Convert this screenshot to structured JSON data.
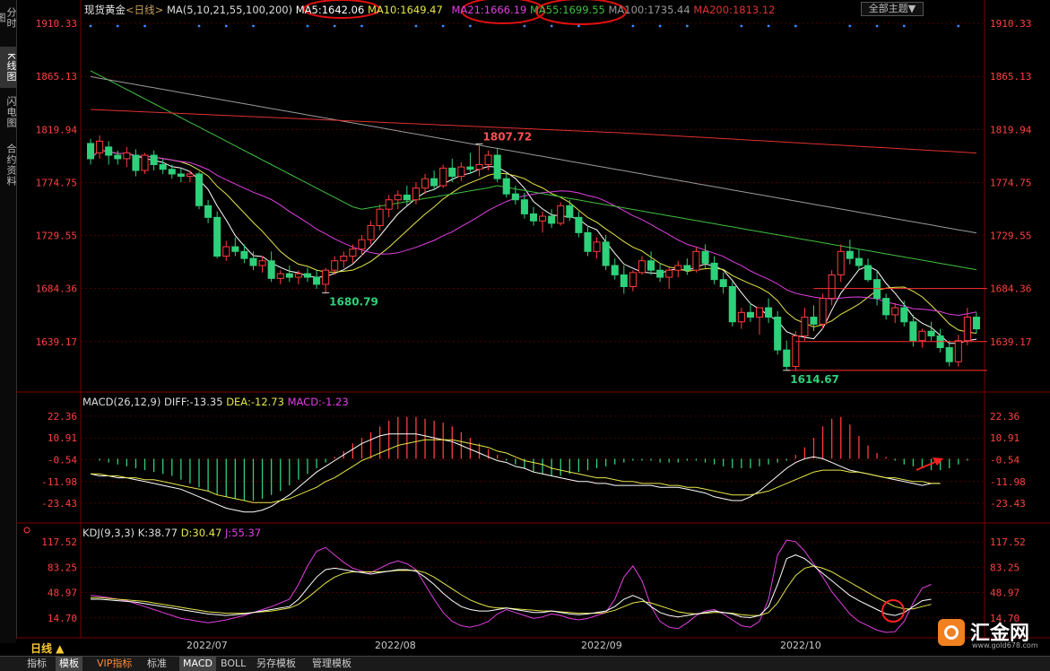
{
  "left_tabs": [
    "分时图",
    "K线图",
    "闪电图",
    "合约资料"
  ],
  "header": {
    "title": "现货黄金",
    "period": "<日线>",
    "ma_params": "MA(5,10,21,55,100,200)",
    "ma_values": [
      {
        "label": "MA5:1642.06",
        "color": "#ffffff"
      },
      {
        "label": "MA10:1649.47",
        "color": "#e6e64a"
      },
      {
        "label": "MA21:1666.19",
        "color": "#e040e0"
      },
      {
        "label": "MA55:1699.55",
        "color": "#40c040"
      },
      {
        "label": "MA100:1735.44",
        "color": "#9a9a9a"
      },
      {
        "label": "MA200:1813.12",
        "color": "#e03030"
      }
    ],
    "theme_button": "全部主题▼"
  },
  "macd_header": {
    "name": "MACD(26,12,9)",
    "diff": "DIFF:-13.35",
    "dea": "DEA:-12.73",
    "macd": "MACD:-1.23"
  },
  "kdj_header": {
    "name": "KDJ(9,3,3)",
    "k": "K:38.77",
    "d": "D:30.47",
    "j": "J:55.37"
  },
  "period_label": "日线 ▲",
  "bottom_tabs": [
    "指标",
    "模板",
    "VIP指标",
    "标准",
    "MACD",
    "BOLL",
    "另存模板",
    "管理模板"
  ],
  "logo_text": "汇金网",
  "logo_url": "www.gold678.com",
  "colors": {
    "up": "#ff3c3c",
    "down": "#2fd07a",
    "grid": "#7a0000",
    "axis_text": "#ff4040"
  },
  "chart_data": [
    {
      "type": "candlestick",
      "title": "现货黄金 日线",
      "y_ticks": [
        1910.33,
        1865.13,
        1819.94,
        1774.75,
        1729.55,
        1684.36,
        1639.17
      ],
      "ylim": [
        1600,
        1915
      ],
      "x_labels": [
        "2022/07",
        "2022/08",
        "2022/09",
        "2022/10"
      ],
      "annotations": [
        {
          "text": "1680.79",
          "value": 1680.79
        },
        {
          "text": "1807.72",
          "value": 1807.72
        },
        {
          "text": "1614.67",
          "value": 1614.67
        }
      ],
      "ohlc": [
        [
          1808,
          1812,
          1790,
          1795
        ],
        [
          1800,
          1815,
          1795,
          1810
        ],
        [
          1805,
          1810,
          1790,
          1798
        ],
        [
          1798,
          1802,
          1790,
          1795
        ],
        [
          1795,
          1805,
          1788,
          1800
        ],
        [
          1798,
          1803,
          1780,
          1785
        ],
        [
          1785,
          1800,
          1782,
          1798
        ],
        [
          1798,
          1802,
          1785,
          1790
        ],
        [
          1790,
          1795,
          1782,
          1786
        ],
        [
          1786,
          1790,
          1778,
          1782
        ],
        [
          1782,
          1787,
          1775,
          1780
        ],
        [
          1780,
          1785,
          1775,
          1782
        ],
        [
          1782,
          1784,
          1752,
          1755
        ],
        [
          1755,
          1760,
          1740,
          1745
        ],
        [
          1745,
          1750,
          1710,
          1712
        ],
        [
          1712,
          1725,
          1708,
          1720
        ],
        [
          1720,
          1728,
          1712,
          1716
        ],
        [
          1716,
          1722,
          1706,
          1710
        ],
        [
          1710,
          1716,
          1700,
          1704
        ],
        [
          1704,
          1712,
          1698,
          1708
        ],
        [
          1708,
          1716,
          1690,
          1693
        ],
        [
          1693,
          1700,
          1688,
          1697
        ],
        [
          1697,
          1704,
          1690,
          1694
        ],
        [
          1694,
          1700,
          1688,
          1697
        ],
        [
          1697,
          1702,
          1690,
          1694
        ],
        [
          1694,
          1700,
          1684,
          1688
        ],
        [
          1688,
          1702,
          1680,
          1700
        ],
        [
          1700,
          1712,
          1696,
          1708
        ],
        [
          1708,
          1716,
          1702,
          1712
        ],
        [
          1712,
          1722,
          1706,
          1718
        ],
        [
          1718,
          1730,
          1712,
          1726
        ],
        [
          1726,
          1742,
          1722,
          1738
        ],
        [
          1738,
          1756,
          1734,
          1752
        ],
        [
          1752,
          1764,
          1745,
          1760
        ],
        [
          1760,
          1768,
          1752,
          1764
        ],
        [
          1764,
          1772,
          1755,
          1760
        ],
        [
          1760,
          1775,
          1756,
          1770
        ],
        [
          1770,
          1782,
          1765,
          1778
        ],
        [
          1778,
          1785,
          1768,
          1772
        ],
        [
          1772,
          1790,
          1770,
          1787
        ],
        [
          1787,
          1795,
          1775,
          1780
        ],
        [
          1780,
          1792,
          1776,
          1788
        ],
        [
          1788,
          1800,
          1782,
          1786
        ],
        [
          1786,
          1807,
          1780,
          1790
        ],
        [
          1790,
          1802,
          1785,
          1798
        ],
        [
          1798,
          1804,
          1775,
          1778
        ],
        [
          1778,
          1782,
          1762,
          1765
        ],
        [
          1765,
          1772,
          1756,
          1760
        ],
        [
          1760,
          1766,
          1744,
          1748
        ],
        [
          1748,
          1754,
          1738,
          1742
        ],
        [
          1742,
          1750,
          1732,
          1746
        ],
        [
          1746,
          1752,
          1736,
          1740
        ],
        [
          1740,
          1758,
          1738,
          1755
        ],
        [
          1755,
          1760,
          1742,
          1745
        ],
        [
          1745,
          1750,
          1728,
          1732
        ],
        [
          1732,
          1738,
          1712,
          1716
        ],
        [
          1716,
          1728,
          1710,
          1724
        ],
        [
          1724,
          1730,
          1700,
          1704
        ],
        [
          1704,
          1710,
          1692,
          1696
        ],
        [
          1696,
          1704,
          1680,
          1686
        ],
        [
          1686,
          1700,
          1682,
          1698
        ],
        [
          1698,
          1712,
          1696,
          1708
        ],
        [
          1708,
          1716,
          1696,
          1700
        ],
        [
          1700,
          1706,
          1690,
          1694
        ],
        [
          1694,
          1702,
          1684,
          1700
        ],
        [
          1700,
          1708,
          1694,
          1704
        ],
        [
          1704,
          1710,
          1696,
          1700
        ],
        [
          1700,
          1720,
          1698,
          1716
        ],
        [
          1716,
          1722,
          1702,
          1706
        ],
        [
          1706,
          1712,
          1688,
          1692
        ],
        [
          1692,
          1698,
          1680,
          1686
        ],
        [
          1686,
          1690,
          1652,
          1656
        ],
        [
          1656,
          1668,
          1650,
          1664
        ],
        [
          1664,
          1672,
          1656,
          1660
        ],
        [
          1660,
          1666,
          1645,
          1668
        ],
        [
          1668,
          1676,
          1655,
          1660
        ],
        [
          1660,
          1665,
          1628,
          1632
        ],
        [
          1632,
          1640,
          1615,
          1618
        ],
        [
          1618,
          1648,
          1614,
          1644
        ],
        [
          1644,
          1668,
          1640,
          1660
        ],
        [
          1660,
          1670,
          1648,
          1654
        ],
        [
          1654,
          1680,
          1650,
          1676
        ],
        [
          1676,
          1700,
          1670,
          1696
        ],
        [
          1696,
          1722,
          1690,
          1716
        ],
        [
          1716,
          1726,
          1705,
          1710
        ],
        [
          1710,
          1718,
          1700,
          1704
        ],
        [
          1704,
          1710,
          1690,
          1692
        ],
        [
          1692,
          1700,
          1670,
          1676
        ],
        [
          1676,
          1680,
          1658,
          1662
        ],
        [
          1662,
          1672,
          1655,
          1668
        ],
        [
          1668,
          1674,
          1652,
          1656
        ],
        [
          1656,
          1662,
          1635,
          1640
        ],
        [
          1640,
          1650,
          1634,
          1648
        ],
        [
          1648,
          1656,
          1640,
          1644
        ],
        [
          1644,
          1650,
          1630,
          1634
        ],
        [
          1634,
          1640,
          1618,
          1622
        ],
        [
          1622,
          1645,
          1618,
          1640
        ],
        [
          1640,
          1668,
          1636,
          1660
        ],
        [
          1660,
          1664,
          1646,
          1650
        ]
      ],
      "series": [
        {
          "name": "MA5",
          "color": "#ffffff"
        },
        {
          "name": "MA10",
          "color": "#e6e64a"
        },
        {
          "name": "MA21",
          "color": "#e040e0"
        },
        {
          "name": "MA55",
          "color": "#40c040"
        },
        {
          "name": "MA100",
          "color": "#9a9a9a"
        },
        {
          "name": "MA200",
          "color": "#e03030"
        }
      ]
    },
    {
      "type": "macd",
      "y_ticks": [
        22.36,
        10.91,
        -0.54,
        -11.98,
        -23.43
      ],
      "ylim": [
        -30,
        28
      ],
      "hist": [
        0,
        -1,
        -2,
        -3,
        -4,
        -5,
        -6,
        -7,
        -8,
        -9,
        -11,
        -13,
        -15,
        -17,
        -19,
        -20,
        -21,
        -22,
        -22,
        -21,
        -19,
        -17,
        -14,
        -11,
        -8,
        -5,
        -2,
        1,
        4,
        8,
        11,
        14,
        17,
        20,
        22,
        22,
        22,
        21,
        20,
        19,
        17,
        14,
        11,
        8,
        5,
        2,
        -1,
        -3,
        -5,
        -7,
        -8,
        -9,
        -9,
        -8,
        -7,
        -6,
        -5,
        -4,
        -3,
        -2,
        -1,
        -1,
        -1,
        -2,
        -2,
        -2,
        -1,
        -1,
        -2,
        -3,
        -4,
        -5,
        -5,
        -5,
        -4,
        -3,
        -2,
        -1,
        2,
        6,
        11,
        17,
        21,
        22,
        18,
        12,
        7,
        3,
        1,
        -1,
        -3,
        -4,
        -5,
        -6,
        -6,
        -5,
        -3,
        -1
      ],
      "diff": [
        -8,
        -9,
        -9,
        -10,
        -10,
        -11,
        -12,
        -13,
        -14,
        -15,
        -16,
        -18,
        -20,
        -22,
        -24,
        -26,
        -27,
        -28,
        -28,
        -27,
        -25,
        -22,
        -19,
        -15,
        -11,
        -7,
        -4,
        -1,
        2,
        5,
        8,
        10,
        12,
        13,
        13,
        13,
        13,
        12,
        11,
        10,
        9,
        7,
        5,
        3,
        1,
        -1,
        -2,
        -4,
        -5,
        -7,
        -8,
        -9,
        -10,
        -11,
        -12,
        -12,
        -13,
        -13,
        -14,
        -14,
        -14,
        -14,
        -14,
        -15,
        -15,
        -15,
        -16,
        -17,
        -18,
        -20,
        -21,
        -22,
        -22,
        -20,
        -17,
        -13,
        -9,
        -5,
        -2,
        0,
        1,
        0,
        -2,
        -4,
        -6,
        -7,
        -8,
        -9,
        -10,
        -11,
        -12,
        -13,
        -14,
        -13,
        -13
      ],
      "dea": [
        -8,
        -8,
        -9,
        -9,
        -10,
        -10,
        -11,
        -11,
        -12,
        -13,
        -14,
        -15,
        -16,
        -17,
        -19,
        -20,
        -21,
        -22,
        -23,
        -23,
        -23,
        -22,
        -21,
        -19,
        -17,
        -15,
        -12,
        -10,
        -7,
        -4,
        -1,
        1,
        3,
        5,
        7,
        8,
        9,
        10,
        10,
        10,
        10,
        9,
        8,
        7,
        6,
        4,
        3,
        1,
        -1,
        -2,
        -3,
        -5,
        -6,
        -7,
        -8,
        -9,
        -10,
        -10,
        -11,
        -12,
        -12,
        -13,
        -13,
        -13,
        -14,
        -14,
        -15,
        -15,
        -16,
        -17,
        -18,
        -19,
        -19,
        -19,
        -18,
        -17,
        -15,
        -13,
        -11,
        -9,
        -7,
        -6,
        -6,
        -6,
        -7,
        -7,
        -8,
        -9,
        -10,
        -10,
        -11,
        -12,
        -12,
        -13,
        -13
      ]
    },
    {
      "type": "kdj",
      "y_ticks": [
        117.52,
        83.25,
        48.97,
        14.7
      ],
      "ylim": [
        -5,
        125
      ],
      "k": [
        40,
        40,
        39,
        38,
        37,
        36,
        34,
        32,
        30,
        28,
        26,
        24,
        22,
        20,
        19,
        18,
        19,
        20,
        22,
        24,
        26,
        28,
        30,
        40,
        55,
        70,
        80,
        82,
        80,
        78,
        76,
        74,
        76,
        78,
        80,
        80,
        78,
        70,
        60,
        48,
        38,
        30,
        26,
        24,
        24,
        26,
        28,
        26,
        24,
        22,
        22,
        24,
        22,
        20,
        19,
        20,
        22,
        24,
        30,
        40,
        45,
        40,
        30,
        22,
        18,
        16,
        18,
        20,
        22,
        24,
        22,
        20,
        16,
        15,
        18,
        30,
        60,
        95,
        100,
        95,
        85,
        75,
        65,
        55,
        45,
        38,
        32,
        26,
        20,
        18,
        22,
        30,
        38,
        40
      ],
      "d": [
        42,
        42,
        41,
        40,
        39,
        38,
        37,
        35,
        33,
        31,
        29,
        27,
        25,
        23,
        22,
        21,
        21,
        21,
        22,
        23,
        24,
        26,
        28,
        33,
        42,
        52,
        62,
        70,
        75,
        77,
        77,
        77,
        77,
        78,
        79,
        79,
        79,
        76,
        70,
        62,
        54,
        46,
        39,
        34,
        30,
        28,
        28,
        27,
        26,
        25,
        24,
        24,
        23,
        22,
        21,
        21,
        21,
        22,
        25,
        30,
        35,
        37,
        35,
        31,
        27,
        23,
        21,
        20,
        21,
        22,
        22,
        21,
        19,
        18,
        18,
        22,
        35,
        55,
        72,
        82,
        85,
        82,
        77,
        70,
        63,
        56,
        49,
        42,
        36,
        30,
        27,
        27,
        30,
        33
      ],
      "j": [
        45,
        44,
        42,
        40,
        38,
        34,
        30,
        26,
        22,
        18,
        14,
        12,
        10,
        8,
        10,
        12,
        15,
        18,
        22,
        26,
        30,
        35,
        40,
        60,
        85,
        105,
        110,
        100,
        90,
        82,
        78,
        76,
        82,
        88,
        92,
        88,
        80,
        60,
        40,
        22,
        10,
        4,
        2,
        5,
        10,
        20,
        26,
        22,
        18,
        14,
        16,
        20,
        18,
        14,
        12,
        14,
        18,
        22,
        40,
        70,
        85,
        65,
        30,
        10,
        2,
        0,
        8,
        18,
        24,
        26,
        20,
        12,
        4,
        2,
        10,
        40,
        100,
        120,
        118,
        105,
        88,
        70,
        50,
        35,
        20,
        10,
        4,
        -2,
        -5,
        -4,
        10,
        35,
        55,
        60
      ]
    }
  ]
}
